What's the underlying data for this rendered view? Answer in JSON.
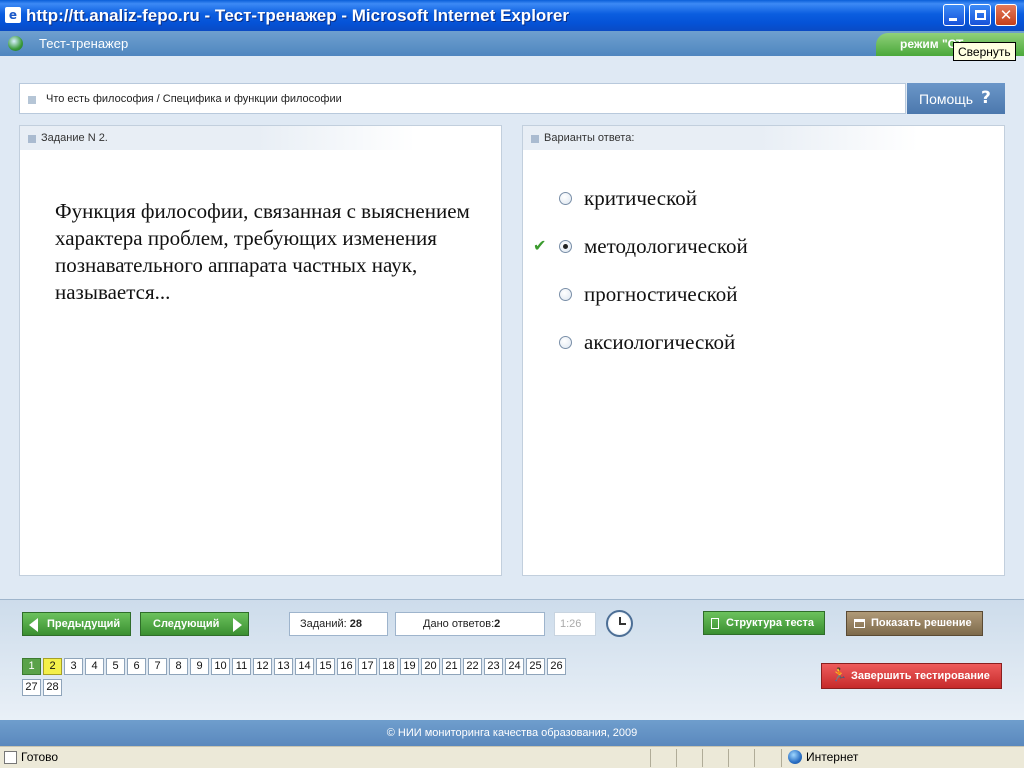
{
  "window": {
    "title": "http://tt.analiz-fepo.ru - Тест-тренажер - Microsoft Internet Explorer",
    "tooltip": "Свернуть",
    "close_glyph": "✕"
  },
  "app": {
    "name": "Тест-тренажер",
    "mode_label": "режим \"СТ"
  },
  "breadcrumb": "Что есть философия / Специфика и функции философии",
  "help": {
    "label": "Помощь",
    "icon": "?"
  },
  "task": {
    "header": "Задание N 2.",
    "text": "Функция философии, связанная с выяснением характера проблем, требующих изменения познавательного аппарата частных наук, называется..."
  },
  "answers": {
    "header": "Варианты ответа:",
    "options": [
      "критической",
      "методологической",
      "прогностической",
      "аксиологической"
    ],
    "selected_index": 1,
    "check_icon": "✔"
  },
  "toolbar": {
    "prev_label": "Предыдущий",
    "next_label": "Следующий",
    "tasks_label": "Заданий:",
    "tasks_count": "28",
    "answered_label": "Дано ответов:",
    "answered_count": "2",
    "timer": "1:26",
    "structure_label": "Структура теста",
    "solution_label": "Показать решение",
    "finish_label": "Завершить тестирование"
  },
  "pages": [
    "1",
    "2",
    "3",
    "4",
    "5",
    "6",
    "7",
    "8",
    "9",
    "10",
    "11",
    "12",
    "13",
    "14",
    "15",
    "16",
    "17",
    "18",
    "19",
    "20",
    "21",
    "22",
    "23",
    "24",
    "25",
    "26",
    "27",
    "28"
  ],
  "footer": "© НИИ мониторинга качества образования, 2009",
  "statusbar": {
    "ready": "Готово",
    "zone": "Интернет"
  },
  "colors": {
    "title_bar": "#0552d6",
    "header_bar": "#5a8ec4",
    "green_button": "#4a9e3e",
    "brown_button": "#8d7756",
    "red_button": "#d43a3a",
    "current_page": "#f3ef4a",
    "answered_page": "#5aa24a"
  }
}
